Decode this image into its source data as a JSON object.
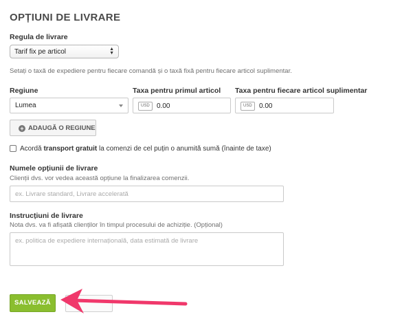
{
  "page": {
    "title": "OPȚIUNI DE LIVRARE"
  },
  "rule": {
    "label": "Regula de livrare",
    "selected": "Tarif fix pe articol",
    "help": "Setați o taxă de expediere pentru fiecare comandă și o taxă fixă pentru fiecare articol suplimentar."
  },
  "rates": {
    "region_label": "Regiune",
    "first_item_label": "Taxa pentru primul articol",
    "additional_item_label": "Taxa pentru fiecare articol suplimentar",
    "region_value": "Lumea",
    "currency": "USD",
    "first_item_value": "0.00",
    "additional_item_value": "0.00",
    "add_region_button": "ADAUGĂ O REGIUNE",
    "add_icon": "plus-circle-icon"
  },
  "free_shipping": {
    "checked": false,
    "text_before": "Acordă ",
    "text_bold": "transport gratuit",
    "text_after": " la comenzi de cel puțin o anumită sumă (înainte de taxe)"
  },
  "option_name": {
    "label": "Numele opțiunii de livrare",
    "help": "Clienții dvs. vor vedea această opțiune la finalizarea comenzii.",
    "placeholder": "ex. Livrare standard, Livrare accelerată"
  },
  "instructions": {
    "label": "Instrucțiuni de livrare",
    "help": "Nota dvs. va fi afișată clienților în timpul procesului de achiziție. (Opțional)",
    "placeholder": "ex. politica de expediere internațională, data estimată de livrare"
  },
  "actions": {
    "save_label": "SALVEAZĂ"
  },
  "colors": {
    "save_green": "#8abe2f",
    "arrow_pink": "#f0386b"
  }
}
